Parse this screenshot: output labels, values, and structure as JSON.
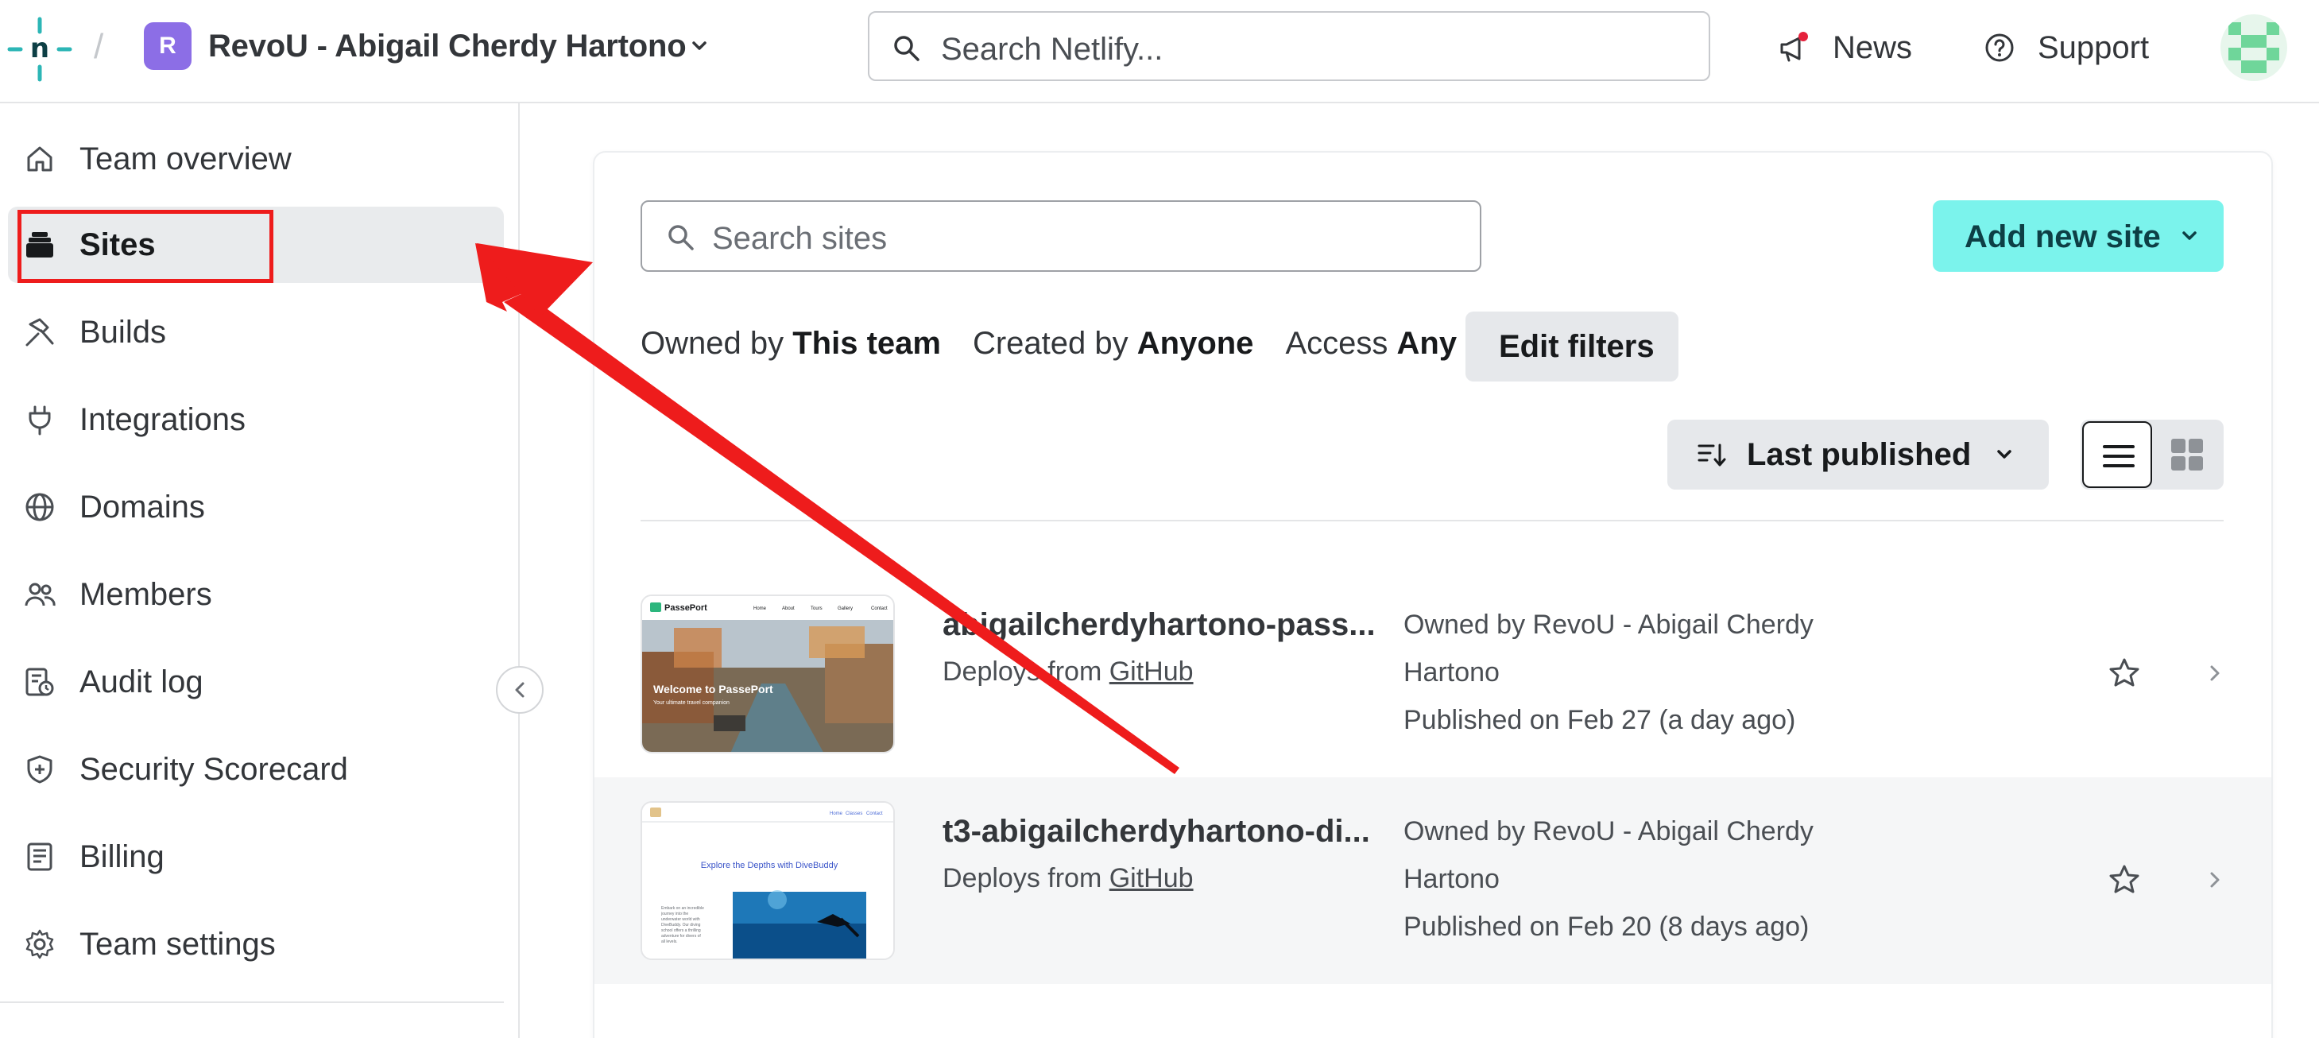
{
  "header": {
    "team_initial": "R",
    "team_name": "RevoU - Abigail Cherdy Hartono",
    "search_placeholder": "Search Netlify...",
    "news_label": "News",
    "support_label": "Support"
  },
  "sidebar": {
    "items": [
      {
        "label": "Team overview",
        "icon": "home-icon"
      },
      {
        "label": "Sites",
        "icon": "sites-icon",
        "active": true
      },
      {
        "label": "Builds",
        "icon": "hammer-icon"
      },
      {
        "label": "Integrations",
        "icon": "plug-icon"
      },
      {
        "label": "Domains",
        "icon": "globe-icon"
      },
      {
        "label": "Members",
        "icon": "members-icon"
      },
      {
        "label": "Audit log",
        "icon": "audit-log-icon"
      },
      {
        "label": "Security Scorecard",
        "icon": "shield-icon"
      },
      {
        "label": "Billing",
        "icon": "receipt-icon"
      },
      {
        "label": "Team settings",
        "icon": "gear-icon"
      }
    ]
  },
  "main": {
    "search_placeholder": "Search sites",
    "add_site_label": "Add new site",
    "filters": {
      "owned_prefix": "Owned by",
      "owned_value": "This team",
      "created_prefix": "Created by",
      "created_value": "Anyone",
      "access_prefix": "Access",
      "access_value": "Any",
      "edit_label": "Edit filters"
    },
    "sort_label": "Last published",
    "sites": [
      {
        "name": "abigailcherdyhartono-pass...",
        "deploys_prefix": "Deploys from",
        "deploys_source": "GitHub",
        "owner_prefix": "Owned by",
        "owner_name": "RevoU - Abigail Cherdy Hartono",
        "published": "Published on Feb 27 (a day ago)",
        "thumb": {
          "brand": "PassePort",
          "nav": [
            "Home",
            "About",
            "Tours",
            "Gallery",
            "Contact"
          ],
          "headline": "Welcome to PassePort",
          "subline": "Your ultimate travel companion"
        }
      },
      {
        "name": "t3-abigailcherdyhartono-di...",
        "deploys_prefix": "Deploys from",
        "deploys_source": "GitHub",
        "owner_prefix": "Owned by",
        "owner_name": "RevoU - Abigail Cherdy Hartono",
        "published": "Published on Feb 20 (8 days ago)",
        "thumb": {
          "nav": [
            "Home",
            "Classes",
            "Contact"
          ],
          "headline": "Explore the Depths with DiveBuddy",
          "body": "Embark on an incredible journey into the underwater world with DiveBuddy. Our diving school offers a thrilling adventure for divers of all levels."
        }
      }
    ]
  },
  "colors": {
    "accent": "#7bf3ec",
    "team_avatar": "#8c6ee6",
    "annotation": "#ee1c1c"
  }
}
